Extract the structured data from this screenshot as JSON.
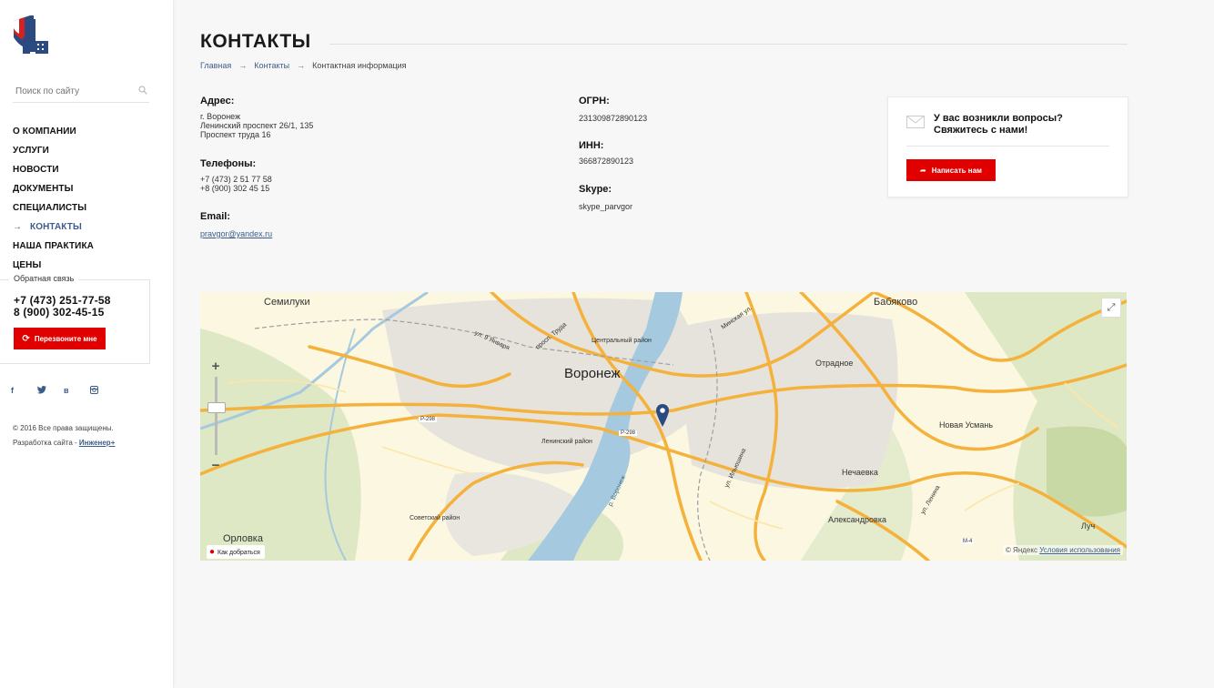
{
  "sidebar": {
    "search_placeholder": "Поиск по сайту",
    "nav": [
      {
        "label": "О компании"
      },
      {
        "label": "Услуги"
      },
      {
        "label": "Новости"
      },
      {
        "label": "Документы"
      },
      {
        "label": "Специалисты"
      },
      {
        "label": "Контакты",
        "active": true
      },
      {
        "label": "Наша практика"
      },
      {
        "label": "Цены"
      }
    ],
    "feedback": {
      "label": "Обратная связь",
      "phone1": "+7 (473) 251-77-58",
      "phone2": "8 (900) 302-45-15",
      "button": "Перезвоните мне"
    },
    "socials": [
      "f",
      "t",
      "в",
      "ig"
    ],
    "copyright": "© 2016 Все права защищены.",
    "dev_prefix": "Разработка сайта - ",
    "dev_link": "Инженер+"
  },
  "page": {
    "title": "Контакты",
    "breadcrumb": [
      "Главная",
      "Контакты",
      "Контактная информация"
    ],
    "address_label": "Адрес:",
    "address": [
      "г. Воронеж",
      "Ленинский проспект 26/1, 135",
      "Проспект труда 16"
    ],
    "phones_label": "Телефоны:",
    "phones": [
      "+7 (473) 2 51 77 58",
      "+8 (900) 302 45 15"
    ],
    "email_label": "Email:",
    "email": "pravgor@yandex.ru",
    "ogrn_label": "ОГРН:",
    "ogrn": "231309872890123",
    "inn_label": "ИНН:",
    "inn": "366872890123",
    "skype_label": "Skype:",
    "skype": "skype_parvgor"
  },
  "contact_box": {
    "question": "У вас возникли вопросы? Свяжитесь с нами!",
    "button": "Написать нам"
  },
  "map": {
    "labels": {
      "semiluki": "Семилуки",
      "voronezh": "Воронеж",
      "babyakovo": "Бабяково",
      "otradnoe": "Отрадное",
      "novaya_usman": "Новая Усмань",
      "nechaevka": "Нечаевка",
      "aleksandrovka": "Александровка",
      "luch": "Луч",
      "orlovka": "Орловка",
      "central": "Центральный район",
      "leninsky": "Ленинский район",
      "sovetsky": "Советский район",
      "r298a": "Р-298",
      "r298b": "Р-298",
      "m4": "М-4",
      "ul9": "ул. 9 Января",
      "prosp": "просп. Труда",
      "minsk": "Минская ул.",
      "ilyushina": "ул. Ильюшина",
      "lenina": "ул. Ленина",
      "river": "р. Воронеж"
    },
    "route": "Как добраться",
    "copyright": "© Яндекс",
    "terms": "Условия использования"
  }
}
